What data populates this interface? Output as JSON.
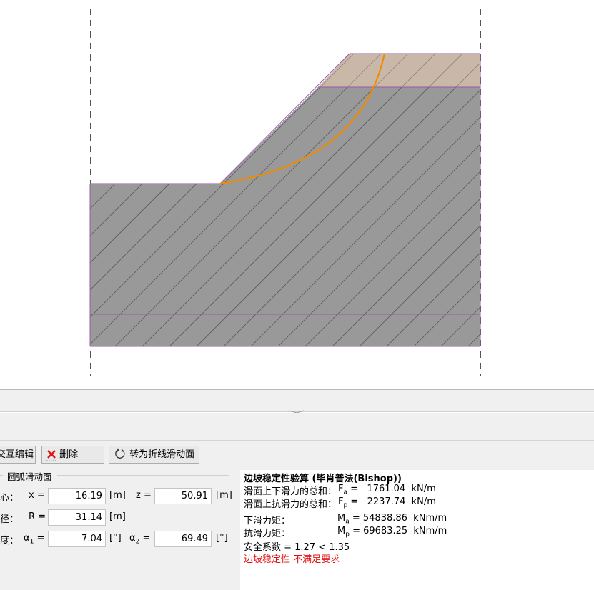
{
  "canvas": {
    "colors": {
      "background": "#ffffff",
      "soil_main": "#999999",
      "soil_top": "#c9b8a8",
      "hatch": "#5a5a5a",
      "layer_line": "#9b59a8",
      "slip_arc": "#f08a00",
      "dash_line": "#555555"
    }
  },
  "splitter": {
    "grip_icon": "grip-icon"
  },
  "toolbar": {
    "interactive_edit_label": "交互编辑",
    "delete_label": "删除",
    "convert_label": "转为折线滑动面"
  },
  "group": {
    "title": "圆弧滑动面"
  },
  "params": {
    "center_label": "圆心：",
    "x_label": "x =",
    "x_value": "16.19",
    "x_unit": "[m]",
    "z_label": "z =",
    "z_value": "50.91",
    "z_unit": "[m]",
    "radius_label": "半径：",
    "r_label": "R =",
    "r_value": "31.14",
    "r_unit": "[m]",
    "angle_label": "角度：",
    "a1_label": "α",
    "a1_sub": "1",
    "a1_eq": " =",
    "a1_value": "7.04",
    "a1_unit": "[°]",
    "a2_label": "α",
    "a2_sub": "2",
    "a2_eq": " =",
    "a2_value": "69.49",
    "a2_unit": "[°]"
  },
  "results": {
    "title": "边坡稳定性验算 (毕肖普法(Bishop))",
    "fa_desc": "滑面上下滑力的总和：",
    "fa_sym": "F",
    "fa_sub": "a",
    "fa_value": " =   1761.04  kN/m",
    "fp_desc": "滑面上抗滑力的总和：",
    "fp_sym": "F",
    "fp_sub": "p",
    "fp_value": " =   2237.74  kN/m",
    "ma_desc": "下滑力矩：",
    "ma_sym": "M",
    "ma_sub": "a",
    "ma_value": " = 54838.86  kNm/m",
    "mp_desc": "抗滑力矩：",
    "mp_sym": "M",
    "mp_sub": "p",
    "mp_value": " = 69683.25  kNm/m",
    "safety": "安全系数 = 1.27 < 1.35",
    "verdict": "边坡稳定性 不满足要求"
  }
}
